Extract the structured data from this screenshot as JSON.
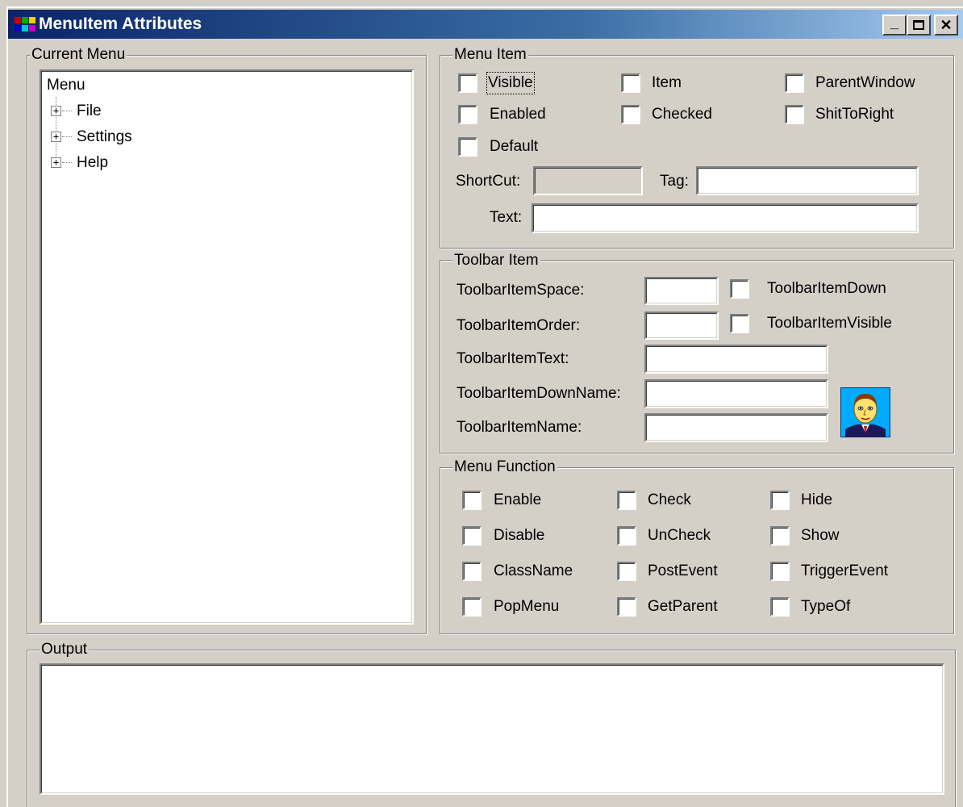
{
  "window": {
    "title": "MenuItem Attributes",
    "min_glyph": "_",
    "max_glyph": "□",
    "close_glyph": "✕"
  },
  "current_menu": {
    "legend": "Current Menu",
    "root": "Menu",
    "items": [
      {
        "label": "File"
      },
      {
        "label": "Settings"
      },
      {
        "label": "Help"
      }
    ],
    "expand_glyph": "+"
  },
  "menu_item": {
    "legend": "Menu Item",
    "checkboxes": {
      "visible": "Visible",
      "item": "Item",
      "parent_window": "ParentWindow",
      "enabled": "Enabled",
      "checked": "Checked",
      "shift_to_right": "ShitToRight",
      "default": "Default"
    },
    "shortcut_label": "ShortCut:",
    "shortcut_value": "",
    "tag_label": "Tag:",
    "tag_value": "",
    "text_label": "Text:",
    "text_value": ""
  },
  "toolbar_item": {
    "legend": "Toolbar Item",
    "space_label": "ToolbarItemSpace:",
    "order_label": "ToolbarItemOrder:",
    "text_label": "ToolbarItemText:",
    "down_name_label": "ToolbarItemDownName:",
    "name_label": "ToolbarItemName:",
    "down_checkbox": "ToolbarItemDown",
    "visible_checkbox": "ToolbarItemVisible",
    "space_value": "",
    "order_value": "",
    "text_value": "",
    "down_name_value": "",
    "name_value": ""
  },
  "menu_function": {
    "legend": "Menu Function",
    "col1": [
      "Enable",
      "Disable",
      "ClassName",
      "PopMenu"
    ],
    "col2": [
      "Check",
      "UnCheck",
      "PostEvent",
      "GetParent"
    ],
    "col3": [
      "Hide",
      "Show",
      "TriggerEvent",
      "TypeOf"
    ]
  },
  "output": {
    "legend": "Output",
    "value": ""
  },
  "icons": {
    "app": "app-icon",
    "toolbar_preview": "person-icon"
  },
  "colors": {
    "title_start": "#0a246a",
    "title_end": "#a6caf0",
    "face": "#d4d0c8"
  }
}
